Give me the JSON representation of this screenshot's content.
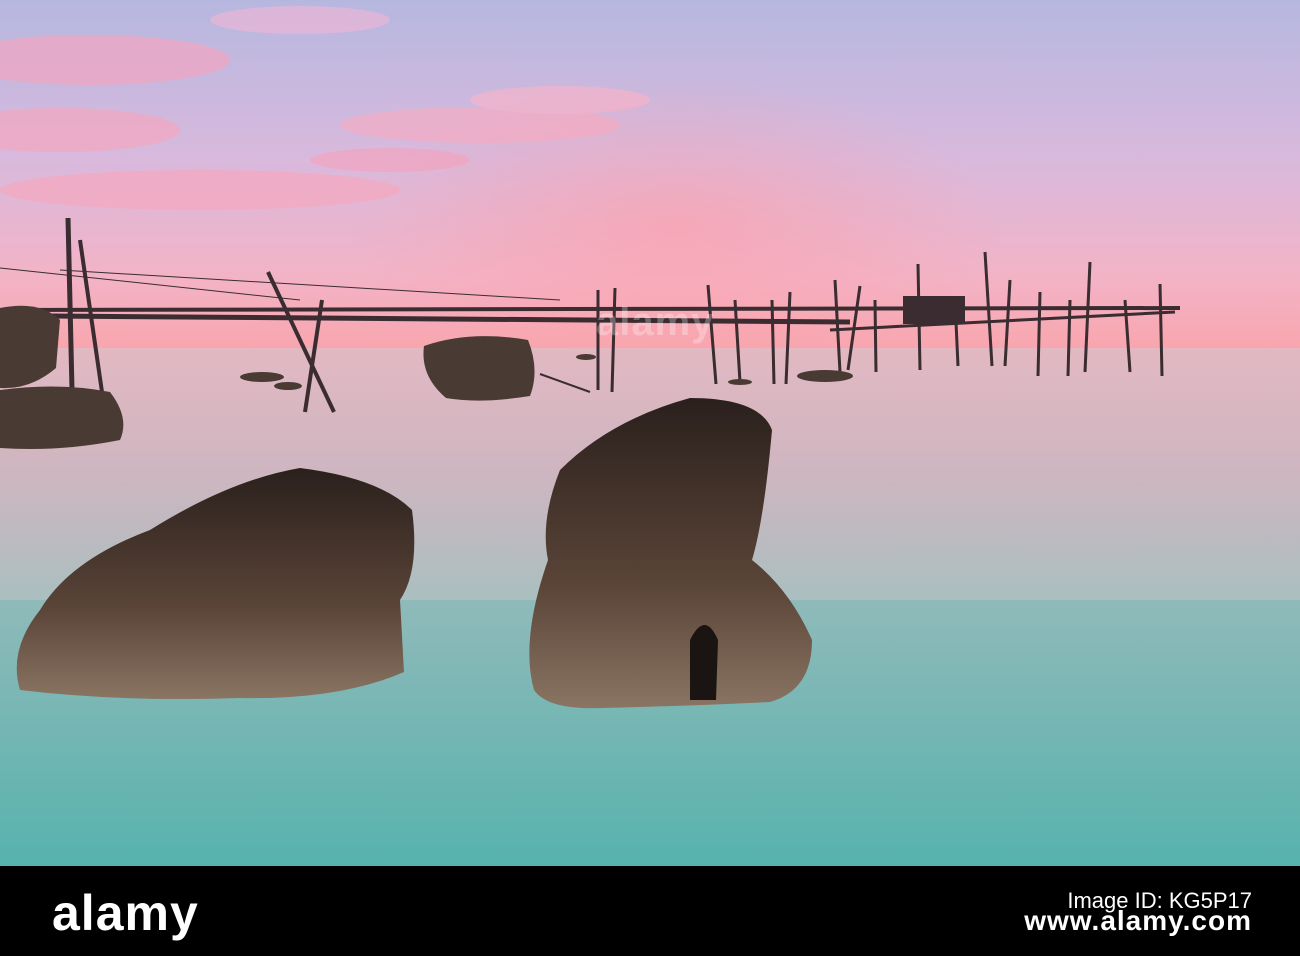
{
  "photo": {
    "description_icon": "trabucco-fishing-platform-at-dawn",
    "colors": {
      "sky_top": "#b9b9df",
      "sky_mid": "#e8b8d6",
      "sky_horizon": "#f7a4b0",
      "sea_far": "#d9b5bf",
      "sea_near": "#6fb8b4",
      "rock": "#3b2b25"
    }
  },
  "watermark": {
    "text": "alamy"
  },
  "banner": {
    "brand": "alamy",
    "image_id_line1": "Image ID: KG5P17",
    "image_id_line2": "www.alamy.com"
  }
}
